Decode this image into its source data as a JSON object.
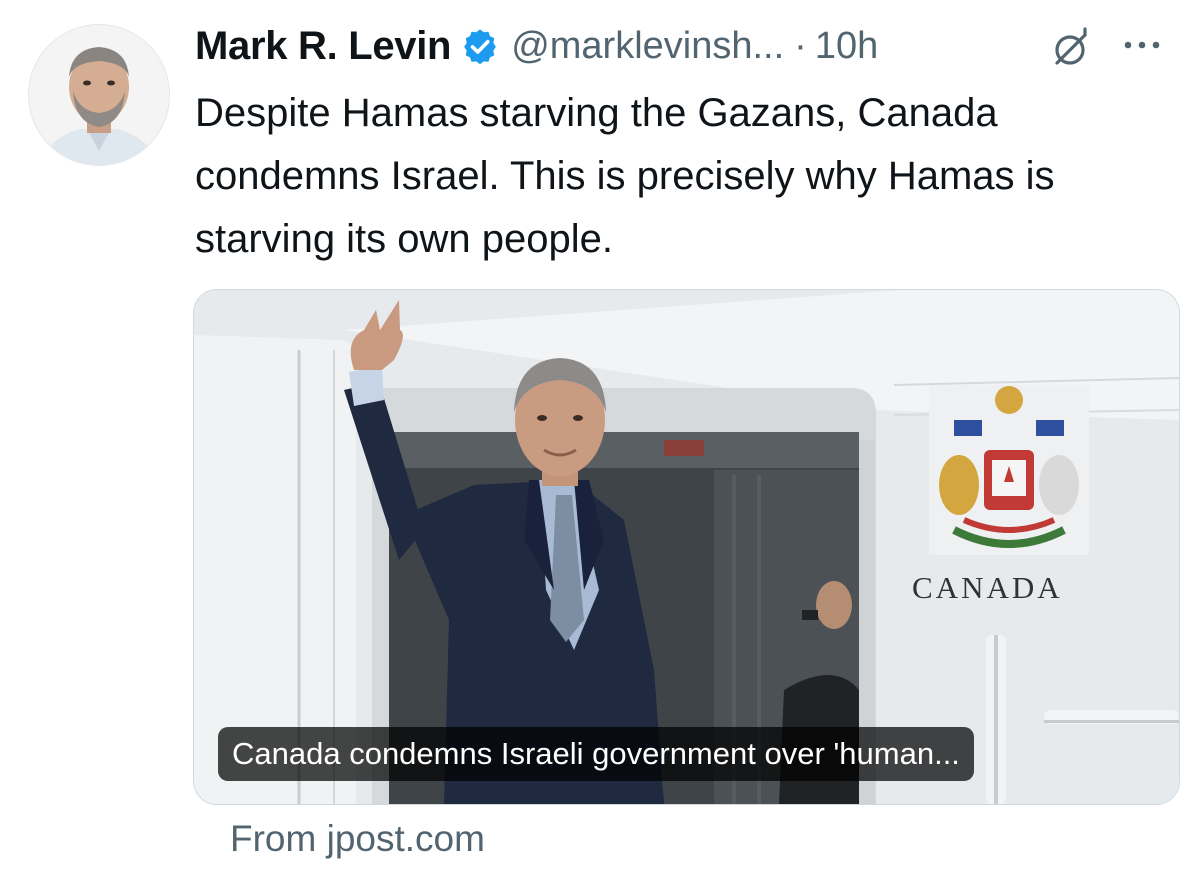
{
  "author": {
    "name": "Mark R. Levin",
    "handle": "@marklevinsh...",
    "separator": "·",
    "time": "10h",
    "verified": true
  },
  "icons": {
    "verified": "verified-badge-icon",
    "grok": "grok-icon",
    "more": "more-options-icon"
  },
  "tweet": {
    "text": "Despite Hamas starving the Gazans, Canada condemns Israel. This is precisely why Hamas is starving its own people."
  },
  "card": {
    "photo_text": "CANADA",
    "caption": "Canada condemns Israeli government over 'human...",
    "source": "From jpost.com"
  },
  "colors": {
    "verified_blue": "#1d9bf0",
    "secondary_text": "#536471",
    "primary_text": "#0f1419"
  }
}
